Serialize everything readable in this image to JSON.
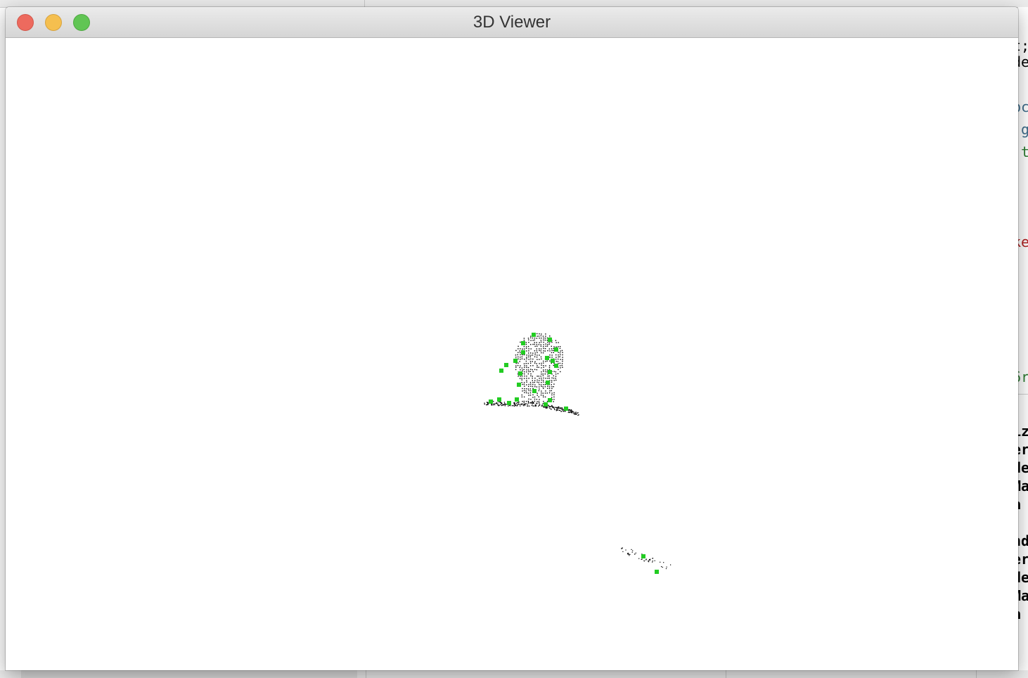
{
  "window": {
    "title": "3D Viewer",
    "controls": {
      "close_icon": "close-icon",
      "minimize_icon": "minimize-icon",
      "zoom_icon": "zoom-icon"
    }
  },
  "viewport": {
    "background": "#ffffff",
    "point_color": "#000000",
    "landmark_color": "#22cc22"
  },
  "background_editor": {
    "code_fragments": [
      {
        "text": "t;",
        "color": "#000000"
      },
      {
        "text": "de",
        "color": "#000000"
      },
      {
        "text": "bc",
        "color": "#3f6e8c"
      },
      {
        "text": ".g",
        "color": "#3f6e8c"
      },
      {
        "text": ".t",
        "color": "#2e7d32"
      },
      {
        "text": "ke",
        "color": "#b22222"
      },
      {
        "text": "6r",
        "color": "#2e7d32"
      },
      {
        "text": "iz",
        "color": "#000000"
      },
      {
        "text": "er",
        "color": "#000000"
      },
      {
        "text": "de",
        "color": "#000000"
      },
      {
        "text": "Ma",
        "color": "#000000"
      },
      {
        "text": " a",
        "color": "#000000"
      },
      {
        "text": "nd",
        "color": "#000000"
      },
      {
        "text": "er",
        "color": "#000000"
      },
      {
        "text": "de",
        "color": "#000000"
      },
      {
        "text": "Ma",
        "color": "#000000"
      },
      {
        "text": " a",
        "color": "#000000"
      }
    ]
  }
}
